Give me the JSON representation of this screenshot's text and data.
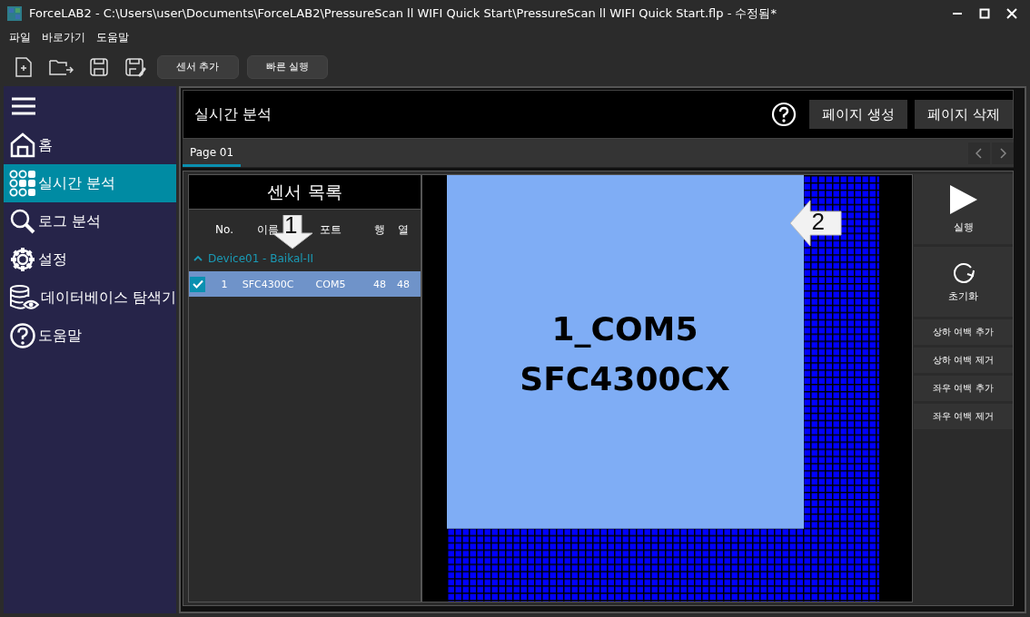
{
  "window": {
    "title": "ForceLAB2 - C:\\Users\\user\\Documents\\ForceLAB2\\PressureScan ll WIFI Quick Start\\PressureScan ll WIFI Quick Start.flp - 수정됨*"
  },
  "menu": [
    "파일",
    "바로가기",
    "도움말"
  ],
  "toolbar": {
    "buttons": [
      "센서 추가",
      "빠른 실행"
    ]
  },
  "sidebar": {
    "items": [
      {
        "label": "홈",
        "selected": false
      },
      {
        "label": "실시간 분석",
        "selected": true
      },
      {
        "label": "로그 분석",
        "selected": false
      },
      {
        "label": "설정",
        "selected": false
      },
      {
        "label": "데이터베이스 탐색기",
        "selected": false
      },
      {
        "label": "도움말",
        "selected": false
      }
    ]
  },
  "panel": {
    "title": "실시간 분석",
    "buttons": [
      "페이지 생성",
      "페이지 삭제"
    ]
  },
  "tabs": [
    {
      "label": "Page 01",
      "selected": true
    }
  ],
  "sensor_list": {
    "title": "센서 목록",
    "columns": [
      "No.",
      "이름",
      "포트",
      "행",
      "열"
    ],
    "groups": [
      {
        "name": "Device01 - Baikal-II",
        "expanded": true,
        "rows": [
          {
            "checked": true,
            "selected": true,
            "cells": [
              "1",
              "SFC4300C",
              "COM5",
              "48",
              "48"
            ]
          }
        ]
      }
    ]
  },
  "sensor_map": {
    "lines": [
      "1_COM5",
      "SFC4300CX"
    ]
  },
  "callouts": [
    {
      "label": "1",
      "kind": "down"
    },
    {
      "label": "2",
      "kind": "left"
    }
  ],
  "controls": [
    {
      "kind": "large",
      "label": "실행"
    },
    {
      "kind": "large",
      "label": "초기화"
    },
    {
      "kind": "small",
      "label": "상하 여백 추가"
    },
    {
      "kind": "small",
      "label": "상하 여백 제거"
    },
    {
      "kind": "small",
      "label": "좌우 여백 추가"
    },
    {
      "kind": "small",
      "label": "좌우 여백 제거"
    }
  ]
}
